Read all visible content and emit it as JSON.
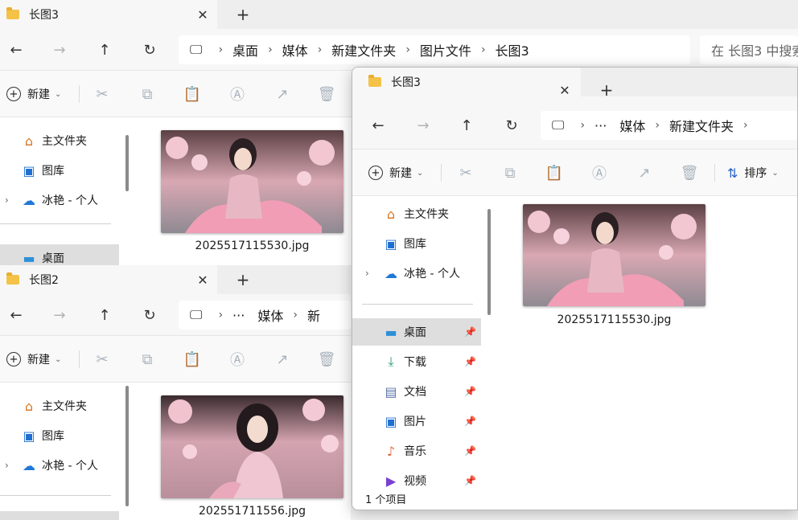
{
  "colors": {
    "accent": "#2a62c8",
    "folder": "#f4c247",
    "selected_bg": "#dedede"
  },
  "icons": {
    "back": "←",
    "forward": "→",
    "up": "↑",
    "refresh": "↻",
    "close": "✕",
    "add": "+",
    "more": "···",
    "sep": "›",
    "pin": "📌",
    "home": "⌂",
    "gallery": "▣",
    "cloud": "☁",
    "desktop": "▬",
    "download": "⤓",
    "document": "▤",
    "picture": "▣",
    "music": "♪",
    "video": "▶",
    "cut": "✂",
    "copy": "⧉",
    "paste": "📋",
    "rename": "Ⓐ",
    "share": "↗",
    "delete": "🗑",
    "sort": "⇅",
    "caret": "⌄",
    "expand": "›"
  },
  "window_back": {
    "tab_title": "长图3",
    "address": [
      "桌面",
      "媒体",
      "新建文件夹",
      "图片文件",
      "长图3"
    ],
    "search_placeholder": "在 长图3 中搜索",
    "new_label": "新建",
    "sidebar": {
      "home": "主文件夹",
      "gallery": "图库",
      "cloud": "冰艳 - 个人",
      "desktop": "桌面"
    },
    "file": "2025517115530.jpg"
  },
  "window_middle": {
    "tab_title": "长图2",
    "address": [
      "媒体",
      "新"
    ],
    "new_label": "新建",
    "sidebar": {
      "home": "主文件夹",
      "gallery": "图库",
      "cloud": "冰艳 - 个人"
    },
    "file": "202551711556.jpg"
  },
  "window_front": {
    "tab_title": "长图3",
    "address": [
      "媒体",
      "新建文件夹"
    ],
    "new_label": "新建",
    "sort_label": "排序",
    "sidebar": {
      "home": "主文件夹",
      "gallery": "图库",
      "cloud": "冰艳 - 个人",
      "quick": [
        {
          "label": "桌面"
        },
        {
          "label": "下载"
        },
        {
          "label": "文档"
        },
        {
          "label": "图片"
        },
        {
          "label": "音乐"
        },
        {
          "label": "视频"
        }
      ]
    },
    "file": "2025517115530.jpg",
    "status": "1 个项目"
  }
}
